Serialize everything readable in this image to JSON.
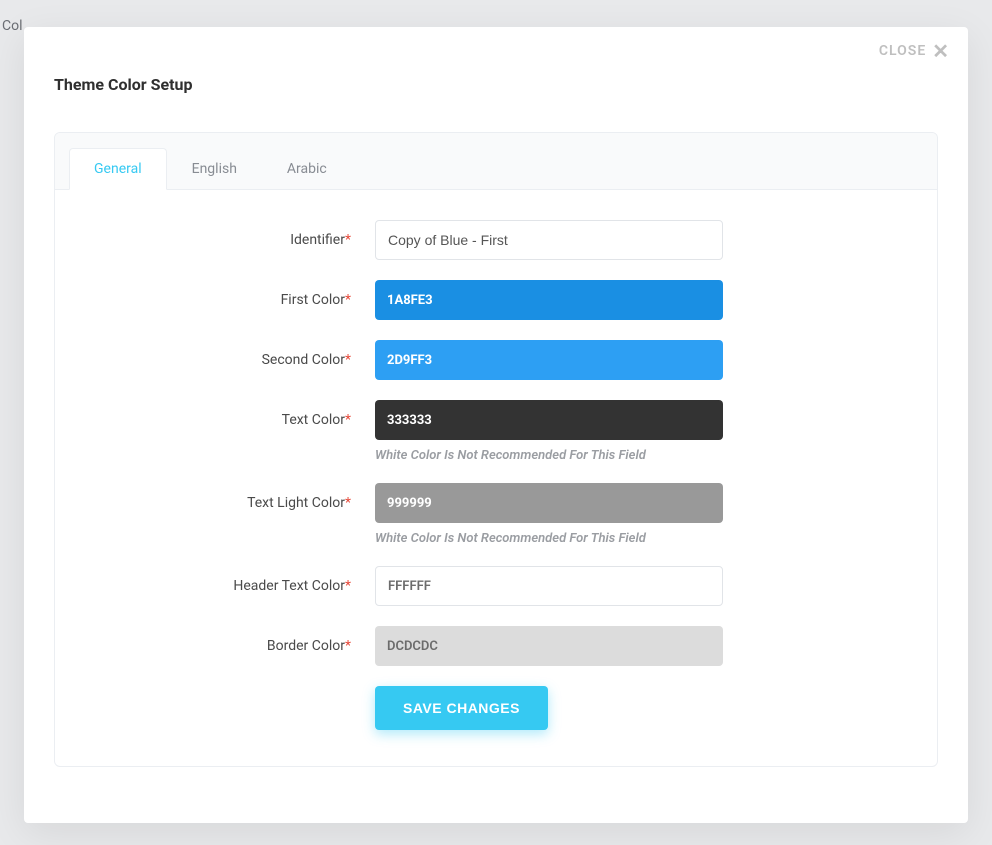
{
  "modal": {
    "close_label": "CLOSE",
    "title": "Theme Color Setup"
  },
  "tabs": [
    {
      "label": "General",
      "active": true
    },
    {
      "label": "English",
      "active": false
    },
    {
      "label": "Arabic",
      "active": false
    }
  ],
  "labels": {
    "identifier": "Identifier",
    "first_color": "First Color",
    "second_color": "Second Color",
    "text_color": "Text Color",
    "text_light_color": "Text Light Color",
    "header_text_color": "Header Text Color",
    "border_color": "Border Color"
  },
  "values": {
    "identifier": "Copy of Blue - First",
    "first_color": "1A8FE3",
    "second_color": "2D9FF3",
    "text_color": "333333",
    "text_light_color": "999999",
    "header_text_color": "FFFFFF",
    "border_color": "DCDCDC"
  },
  "colors": {
    "first_color_bg": "#1A8FE3",
    "second_color_bg": "#2D9FF3",
    "text_color_bg": "#333333",
    "text_light_color_bg": "#999999",
    "header_text_color_bg": "#FFFFFF",
    "border_color_bg": "#DCDCDC"
  },
  "hints": {
    "white_not_recommended": "White Color Is Not Recommended For This Field"
  },
  "buttons": {
    "save": "SAVE CHANGES"
  },
  "background": {
    "left_text": "Col"
  }
}
